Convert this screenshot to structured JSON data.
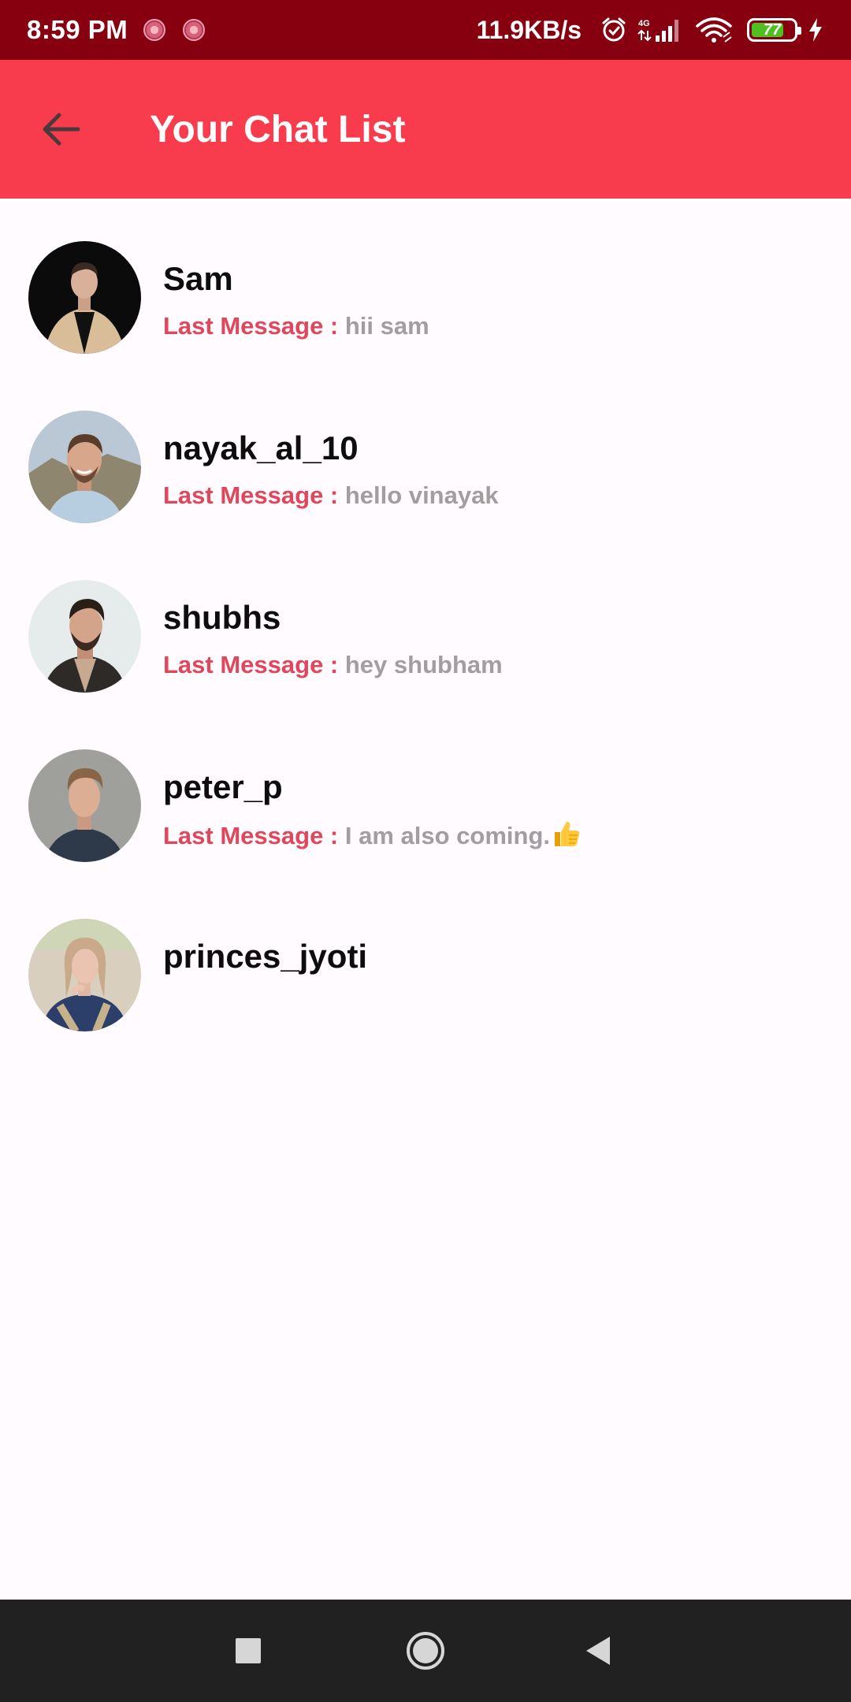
{
  "status_bar": {
    "time": "8:59 PM",
    "speed": "11.9KB/s",
    "network_type": "4G",
    "battery": "77",
    "battery_level_percent": 77,
    "icons": [
      "notification-dot-icon",
      "notification-dot-icon",
      "alarm-icon",
      "signal-icon",
      "wifi-icon",
      "battery-icon",
      "charging-icon"
    ]
  },
  "app_bar": {
    "title": "Your Chat List",
    "back_icon": "arrow-left-icon",
    "color": "#f83c4e"
  },
  "chats": [
    {
      "name": "Sam",
      "last_label": "Last Message : ",
      "last_message": "hii sam",
      "emoji": ""
    },
    {
      "name": "nayak_al_10",
      "last_label": "Last Message : ",
      "last_message": "hello vinayak",
      "emoji": ""
    },
    {
      "name": "shubhs",
      "last_label": "Last Message : ",
      "last_message": "hey shubham",
      "emoji": ""
    },
    {
      "name": "peter_p",
      "last_label": "Last Message : ",
      "last_message": "I am also coming.",
      "emoji": "thumbs-up-icon"
    },
    {
      "name": "princes_jyoti",
      "last_label": "",
      "last_message": "",
      "emoji": ""
    }
  ],
  "colors": {
    "status_bar": "#870010",
    "accent": "#f83c4e",
    "label": "#e0475a",
    "message": "#a29d9f"
  },
  "nav_bar": {
    "buttons": [
      "recents-square-icon",
      "home-circle-icon",
      "back-triangle-icon"
    ]
  }
}
